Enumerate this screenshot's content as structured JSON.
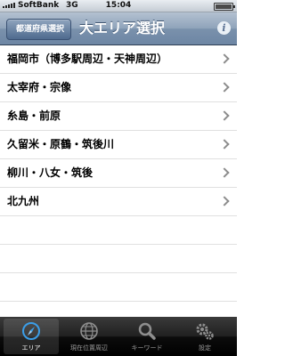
{
  "status_bar": {
    "carrier": "SoftBank",
    "network": "3G",
    "time": "15:04"
  },
  "nav": {
    "back_label": "都道府県選択",
    "title": "大エリア選択",
    "info_icon": "i"
  },
  "list": {
    "items": [
      {
        "label": "福岡市（博多駅周辺・天神周辺）"
      },
      {
        "label": "太宰府・宗像"
      },
      {
        "label": "糸島・前原"
      },
      {
        "label": "久留米・原鶴・筑後川"
      },
      {
        "label": "柳川・八女・筑後"
      },
      {
        "label": "北九州"
      }
    ]
  },
  "tabbar": {
    "tabs": [
      {
        "label": "エリア",
        "icon": "compass-icon",
        "active": true
      },
      {
        "label": "現在位置周辺",
        "icon": "globe-icon",
        "active": false
      },
      {
        "label": "キーワード",
        "icon": "search-icon",
        "active": false
      },
      {
        "label": "設定",
        "icon": "gear-icon",
        "active": false
      }
    ]
  },
  "colors": {
    "nav_bar": "#7a91ac",
    "active_icon": "#3b9ee8"
  }
}
